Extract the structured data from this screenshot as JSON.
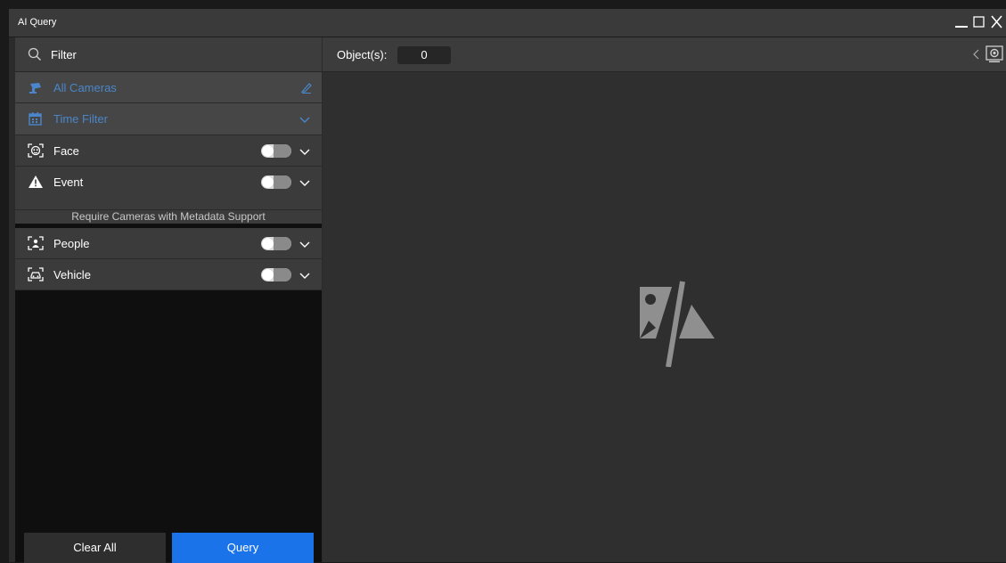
{
  "window": {
    "title": "AI Query",
    "controls": [
      "minimize-icon",
      "maximize-icon",
      "close-icon"
    ]
  },
  "filter": {
    "label": "Filter",
    "icon": "search-icon"
  },
  "sections": [
    {
      "id": "all-cameras",
      "label": "All Cameras",
      "icon": "camera-icon",
      "action_icon": "edit-icon",
      "dimmed": true
    },
    {
      "id": "time-filter",
      "label": "Time Filter",
      "icon": "calendar-icon",
      "action_icon": "chevron-down-icon",
      "dimmed": true
    },
    {
      "id": "face",
      "label": "Face",
      "icon": "face-icon",
      "toggle": false
    },
    {
      "id": "event",
      "label": "Event",
      "icon": "warning-icon",
      "toggle": false
    },
    {
      "id": "people",
      "label": "People",
      "icon": "person-icon",
      "toggle": false
    },
    {
      "id": "vehicle",
      "label": "Vehicle",
      "icon": "vehicle-icon",
      "toggle": false
    }
  ],
  "metadata_note": "Require Cameras with Metadata Support",
  "buttons": {
    "clear": "Clear All",
    "query": "Query"
  },
  "results": {
    "objects_label": "Object(s):",
    "objects_count": "0",
    "placeholder_icon": "no-image-icon"
  },
  "colors": {
    "accent": "#1a73e8",
    "dim_label": "#4a86c9",
    "panel_bg": "#2f2f2f",
    "sidebar_bg": "#0f0f0f"
  }
}
